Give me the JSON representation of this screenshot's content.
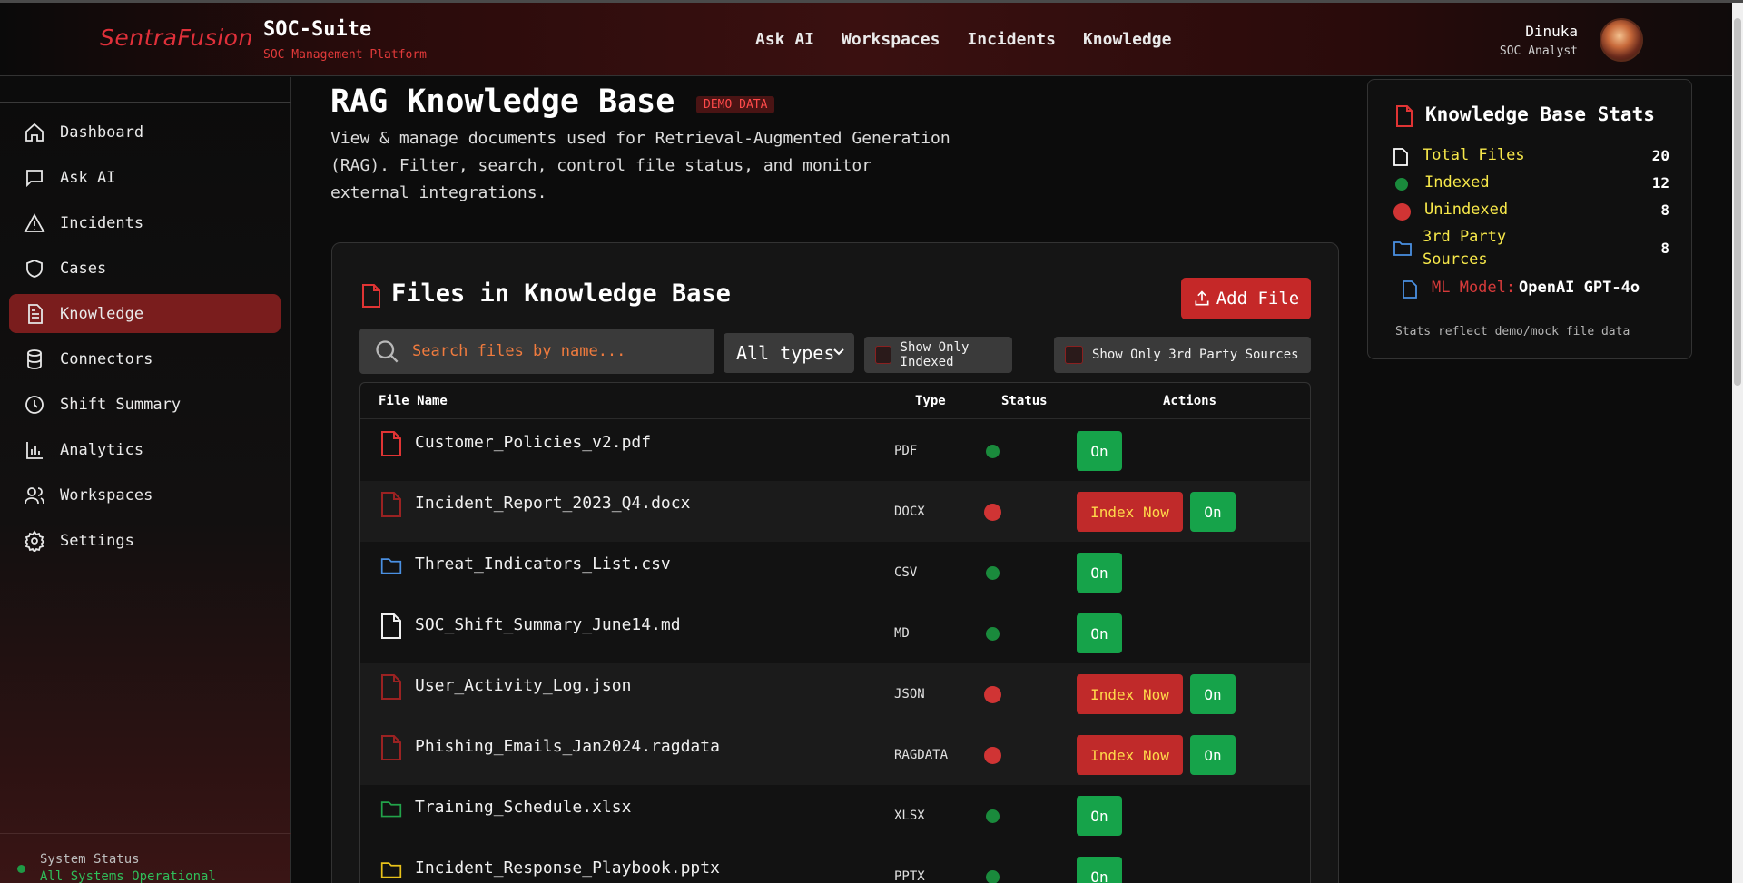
{
  "header": {
    "logo": "SentraFusion",
    "app_title": "SOC-Suite",
    "app_subtitle": "SOC Management Platform",
    "nav": [
      "Ask AI",
      "Workspaces",
      "Incidents",
      "Knowledge"
    ],
    "user_name": "Dinuka",
    "user_role": "SOC Analyst"
  },
  "sidebar": {
    "items": [
      {
        "label": "Dashboard",
        "icon": "home-icon"
      },
      {
        "label": "Ask AI",
        "icon": "chat-icon"
      },
      {
        "label": "Incidents",
        "icon": "alert-triangle-icon"
      },
      {
        "label": "Cases",
        "icon": "shield-icon"
      },
      {
        "label": "Knowledge",
        "icon": "document-icon",
        "active": true
      },
      {
        "label": "Connectors",
        "icon": "database-icon"
      },
      {
        "label": "Shift Summary",
        "icon": "clock-icon"
      },
      {
        "label": "Analytics",
        "icon": "bar-chart-icon"
      },
      {
        "label": "Workspaces",
        "icon": "users-icon"
      },
      {
        "label": "Settings",
        "icon": "gear-icon"
      }
    ],
    "system_status_label": "System Status",
    "system_status_value": "All Systems Operational"
  },
  "main": {
    "title": "RAG Knowledge Base",
    "badge": "DEMO DATA",
    "description": "View & manage documents used for Retrieval-Augmented Generation (RAG). Filter, search, control file status, and monitor external integrations.",
    "files_card": {
      "title": "Files in Knowledge Base",
      "add_button": "Add File",
      "search_placeholder": "Search files by name...",
      "type_filter": "All types",
      "filter_indexed": "Show Only Indexed",
      "filter_third_party": "Show Only 3rd Party Sources",
      "columns": [
        "File Name",
        "Type",
        "Status",
        "Actions"
      ],
      "index_button": "Index Now",
      "on_button": "On",
      "rows": [
        {
          "name": "Customer_Policies_v2.pdf",
          "type": "PDF",
          "indexed": true,
          "icon": "file-icon"
        },
        {
          "name": "Incident_Report_2023_Q4.docx",
          "type": "DOCX",
          "indexed": false,
          "icon": "file-icon"
        },
        {
          "name": "Threat_Indicators_List.csv",
          "type": "CSV",
          "indexed": true,
          "icon": "folder-icon"
        },
        {
          "name": "SOC_Shift_Summary_June14.md",
          "type": "MD",
          "indexed": true,
          "icon": "file-icon"
        },
        {
          "name": "User_Activity_Log.json",
          "type": "JSON",
          "indexed": false,
          "icon": "file-icon"
        },
        {
          "name": "Phishing_Emails_Jan2024.ragdata",
          "type": "RAGDATA",
          "indexed": false,
          "icon": "file-icon"
        },
        {
          "name": "Training_Schedule.xlsx",
          "type": "XLSX",
          "indexed": true,
          "icon": "folder-icon"
        },
        {
          "name": "Incident_Response_Playbook.pptx",
          "type": "PPTX",
          "indexed": true,
          "icon": "folder-icon"
        }
      ]
    }
  },
  "stats": {
    "title": "Knowledge Base Stats",
    "total_files_label": "Total Files",
    "total_files_value": "20",
    "indexed_label": "Indexed",
    "indexed_value": "12",
    "unindexed_label": "Unindexed",
    "unindexed_value": "8",
    "third_party_label": "3rd Party Sources",
    "third_party_value": "8",
    "ml_model_label": "ML Model:",
    "ml_model_value": "OpenAI GPT-4o",
    "footnote": "Stats reflect demo/mock file data"
  },
  "colors": {
    "accent_red": "#c52828",
    "active_nav": "#7a1d1d",
    "green": "#16a34a",
    "status_ok": "#2fbf5a",
    "warning_yellow": "#f7e84a"
  }
}
